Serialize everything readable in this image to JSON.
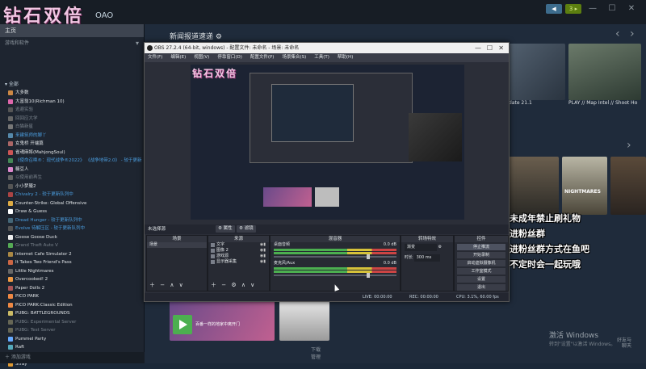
{
  "app": {
    "logo_text": "钻石双倍",
    "user_suffix": "OAO",
    "top_buttons": [
      "◀",
      "3 ▸"
    ],
    "window_controls": [
      "—",
      "☐",
      "✕"
    ]
  },
  "sidebar": {
    "home": "主页",
    "category": "游戏和软件",
    "section_header": "▾ 全部",
    "games": [
      {
        "name": "大多数",
        "style": "normal",
        "color": "#c84"
      },
      {
        "name": "大富翁10(Richman 10)",
        "style": "normal",
        "color": "#d6a"
      },
      {
        "name": "逃避实验",
        "style": "dim",
        "color": "#555"
      },
      {
        "name": "回回应大学",
        "style": "dim",
        "color": "#666"
      },
      {
        "name": "白猫新星",
        "style": "dim",
        "color": "#777"
      },
      {
        "name": "来建筑师的脚丫",
        "style": "update",
        "color": "#58a"
      },
      {
        "name": "女鬼桥 开端篇",
        "style": "normal",
        "color": "#a66"
      },
      {
        "name": "雀魂麻将(MahjongSoul)",
        "style": "normal",
        "color": "#c55"
      },
      {
        "name": "《使命召唤®：现代战争®2022》 《战争地带2.0》 - 较于更新",
        "style": "update",
        "color": "#485"
      },
      {
        "name": "糖豆人",
        "style": "normal",
        "color": "#d8c"
      },
      {
        "name": "以使用前再生",
        "style": "dim",
        "color": "#666"
      },
      {
        "name": "小小梦魇2",
        "style": "normal",
        "color": "#555"
      },
      {
        "name": "Chivalry 2 - 较于更新队列中",
        "style": "update",
        "color": "#a44"
      },
      {
        "name": "Counter-Strike: Global Offensive",
        "style": "normal",
        "color": "#da4"
      },
      {
        "name": "Draw & Guess",
        "style": "normal",
        "color": "#fff"
      },
      {
        "name": "Dread Hunger - 较于更新队列中",
        "style": "update",
        "color": "#467"
      },
      {
        "name": "Evolve 待解压区 - 较于更新队列中",
        "style": "update",
        "color": "#555"
      },
      {
        "name": "Goose Goose Duck",
        "style": "normal",
        "color": "#eee"
      },
      {
        "name": "Grand Theft Auto V",
        "style": "dim",
        "color": "#5a5"
      },
      {
        "name": "Internet Cafe Simulator 2",
        "style": "normal",
        "color": "#a84"
      },
      {
        "name": "It Takes Two Friend's Pass",
        "style": "normal",
        "color": "#c64"
      },
      {
        "name": "Little Nightmares",
        "style": "normal",
        "color": "#666"
      },
      {
        "name": "Overcooked! 2",
        "style": "normal",
        "color": "#e94"
      },
      {
        "name": "Paper Dolls 2",
        "style": "normal",
        "color": "#a55"
      },
      {
        "name": "PICO PARK",
        "style": "normal",
        "color": "#e84"
      },
      {
        "name": "PICO PARK:Classic Edition",
        "style": "normal",
        "color": "#e84"
      },
      {
        "name": "PUBG: BATTLEGROUNDS",
        "style": "normal",
        "color": "#cb6"
      },
      {
        "name": "PUBG: Experimental Server",
        "style": "dim",
        "color": "#665"
      },
      {
        "name": "PUBG: Test Server",
        "style": "dim",
        "color": "#665"
      },
      {
        "name": "Pummel Party",
        "style": "normal",
        "color": "#6af"
      },
      {
        "name": "Raft",
        "style": "normal",
        "color": "#5ab"
      },
      {
        "name": "Red Dead Redemption 2",
        "style": "normal",
        "color": "#a33"
      },
      {
        "name": "Stray",
        "style": "normal",
        "color": "#d93"
      }
    ],
    "footer": "添加游戏"
  },
  "main": {
    "news_header": "新闻报道速递 ⚙",
    "tiles": {
      "update_caption": "date 21.1",
      "map_caption": "PLAY // Map Intel // Shoot Ho",
      "downloads": "下载",
      "downloads_sub": "管理",
      "friends_line1": "好友与",
      "friends_line2": "聊天"
    },
    "nightmares_label": "NIGHTMARES",
    "promo_lines": [
      "未成年禁止刷礼物",
      "进粉丝群",
      "进粉丝群方式在鱼吧",
      "不定时会一起玩哦"
    ],
    "tile_text": "百番一样的地家中离开门",
    "activate_line1": "激活 Windows",
    "activate_line2": "转到\"设置\"以激活 Windows。"
  },
  "obs": {
    "title": "OBS 27.2.4 (64-bit, windows) - 配置文件: 未命名 - 场景: 未命名",
    "menu": [
      "文件(F)",
      "编辑(E)",
      "视图(V)",
      "停靠窗口(D)",
      "配置文件(P)",
      "场景集合(S)",
      "工具(T)",
      "帮助(H)"
    ],
    "scene_bar_label": "未选择源",
    "scene_tabs": [
      "⚙ 属性",
      "⚙ 滤镜"
    ],
    "docks": {
      "scenes": {
        "title": "场景",
        "items": [
          "场景"
        ]
      },
      "sources": {
        "title": "来源",
        "items": [
          "文字",
          "图像 2",
          "游戏源",
          "显示器采集"
        ]
      },
      "mixer": {
        "title": "混音器",
        "channels": [
          {
            "label": "桌面音频",
            "db": "0.0 dB"
          },
          {
            "label": "麦克风/Aux",
            "db": "0.0 dB"
          }
        ]
      },
      "transitions": {
        "title": "转场特效",
        "type": "渐变",
        "duration_label": "时长",
        "duration": "300 ms"
      },
      "controls": {
        "title": "控件",
        "buttons": [
          "停止推流",
          "开始录制",
          "启动虚拟摄像机",
          "工作室模式",
          "设置",
          "退出"
        ]
      }
    },
    "status": {
      "live": "LIVE: 00:00:00",
      "rec": "REC: 00:00:00",
      "cpu": "CPU: 3.1%, 60.00 fps"
    }
  }
}
